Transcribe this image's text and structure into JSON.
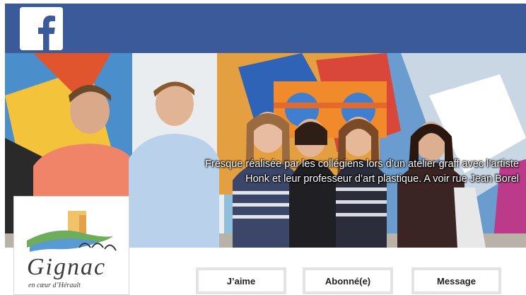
{
  "header": {
    "logo_icon": "facebook-f-icon",
    "bar_color": "#3b5a9a"
  },
  "cover": {
    "caption_line1": "Fresque réalisée par les collégiens lors d’un atelier graff avec l’artiste",
    "caption_line2": "Honk et leur professeur d’art plastique. A voir rue Jean Borel"
  },
  "profile": {
    "logo_text": "Gignac",
    "logo_tagline": "en cœur d’Hérault"
  },
  "actions": {
    "like_label": "J’aime",
    "subscribed_label": "Abonné(e)",
    "message_label": "Message"
  }
}
